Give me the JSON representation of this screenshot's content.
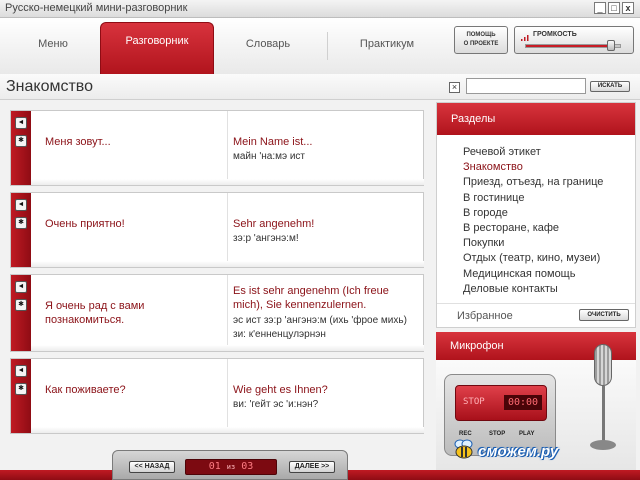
{
  "window": {
    "title": "Русско-немецкий мини-разговорник",
    "minimize": "_",
    "maximize": "□",
    "close": "x"
  },
  "nav": {
    "tabs": [
      {
        "label": "Меню"
      },
      {
        "label": "Разговорник",
        "active": true
      },
      {
        "label": "Словарь"
      },
      {
        "label": "Практикум"
      }
    ],
    "help_line1": "ПОМОЩЬ",
    "help_line2": "О ПРОЕКТЕ",
    "volume_label": "ГРОМКОСТЬ",
    "volume_level": 0.9
  },
  "section": {
    "title": "Знакомство",
    "clear_glyph": "×",
    "search_value": "",
    "search_button": "ИСКАТЬ"
  },
  "phrases": [
    {
      "ru": "Меня зовут...",
      "de": "Mein Name ist...",
      "transcription": "майн 'на:мэ ист"
    },
    {
      "ru": "Очень приятно!",
      "de": "Sehr angenehm!",
      "transcription": "зэ:р 'ангэнэ:м!"
    },
    {
      "ru": "Я очень рад с вами познакомиться.",
      "de": "Es ist sehr angenehm (Ich freue mich), Sie kennenzulernen.",
      "transcription": "эс ист зэ:р 'ангэнэ:м (ихь 'фрое михь) зи: к'енненцулэрнэн"
    },
    {
      "ru": "Как поживаете?",
      "de": "Wie geht es Ihnen?",
      "transcription": "ви: 'гейт эс 'и:нэн?"
    }
  ],
  "phrase_buttons": {
    "play": "◄",
    "favorite": "✱"
  },
  "sidebar": {
    "heading": "Разделы",
    "items": [
      {
        "label": "Речевой этикет"
      },
      {
        "label": "Знакомство",
        "active": true
      },
      {
        "label": "Приезд, отъезд, на границе"
      },
      {
        "label": "В гостинице"
      },
      {
        "label": "В городе"
      },
      {
        "label": "В ресторане, кафе"
      },
      {
        "label": "Покупки"
      },
      {
        "label": "Отдых (театр, кино, музеи)"
      },
      {
        "label": "Медицинская помощь"
      },
      {
        "label": "Деловые контакты"
      }
    ],
    "favorites": "Избранное",
    "clear_button": "ОЧИСТИТЬ"
  },
  "microphone": {
    "heading": "Микрофон",
    "stop_label": "STOP",
    "time": "00:00",
    "rec": "REC",
    "stop": "STOP",
    "play": "PLAY"
  },
  "pager": {
    "prev": "<< НАЗАД",
    "next": "ДАЛЕЕ >>",
    "current": "01",
    "of": "из",
    "total": "03"
  },
  "watermark": "сможем.ру",
  "colors": {
    "accent": "#c01a23",
    "accent_dark": "#8f0c14",
    "text_red": "#8b1218"
  }
}
